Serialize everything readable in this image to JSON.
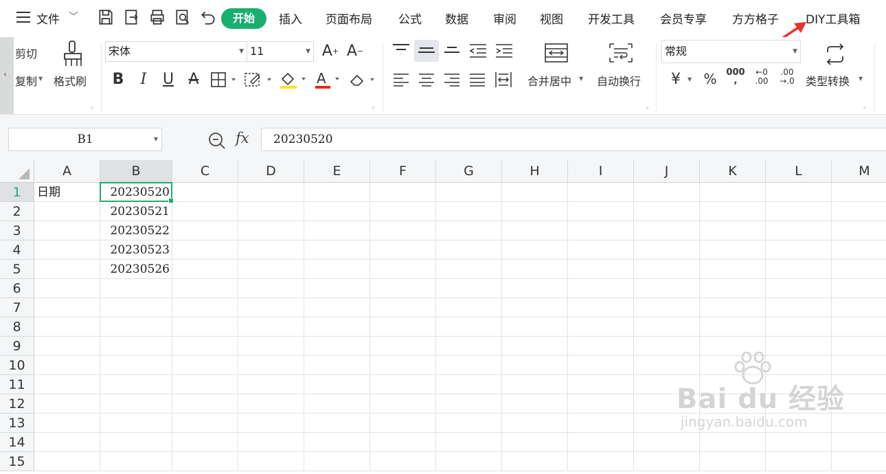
{
  "menu": {
    "file": "文件",
    "tabs": [
      "开始",
      "插入",
      "页面布局",
      "公式",
      "数据",
      "审阅",
      "视图",
      "开发工具",
      "会员专享",
      "方方格子",
      "DIY工具箱"
    ],
    "active_tab_color": "#1aae6f",
    "annotation_arrow_color": "#e8322b"
  },
  "ribbon": {
    "clipboard": {
      "cut": "剪切",
      "copy": "复制",
      "format_painter": "格式刷"
    },
    "font": {
      "name": "宋体",
      "size": "11"
    },
    "alignment": {
      "merge_center": "合并居中",
      "wrap_text": "自动换行"
    },
    "number": {
      "format": "常规",
      "currency": "¥",
      "percent": "%",
      "thousands": "000",
      "dec_increase": "←0 .00",
      "dec_decrease": ".00 →.0",
      "type_convert": "类型转换"
    }
  },
  "formula_bar": {
    "cell_ref": "B1",
    "fx_label": "fx",
    "value": "20230520"
  },
  "grid": {
    "columns": [
      "A",
      "B",
      "C",
      "D",
      "E",
      "F",
      "G",
      "H",
      "I",
      "J",
      "K",
      "L",
      "M"
    ],
    "rows": [
      "1",
      "2",
      "3",
      "4",
      "5",
      "6",
      "7",
      "8",
      "9",
      "10",
      "11",
      "12",
      "13",
      "14",
      "15"
    ],
    "selected_cell": "B1",
    "selection_color": "#1aae6f",
    "cells": {
      "A1": "日期",
      "B1": "20230520",
      "B2": "20230521",
      "B3": "20230522",
      "B4": "20230523",
      "B5": "20230526"
    }
  },
  "watermark": {
    "brand": "Bai du 经验",
    "url": "jingyan.baidu.com"
  }
}
